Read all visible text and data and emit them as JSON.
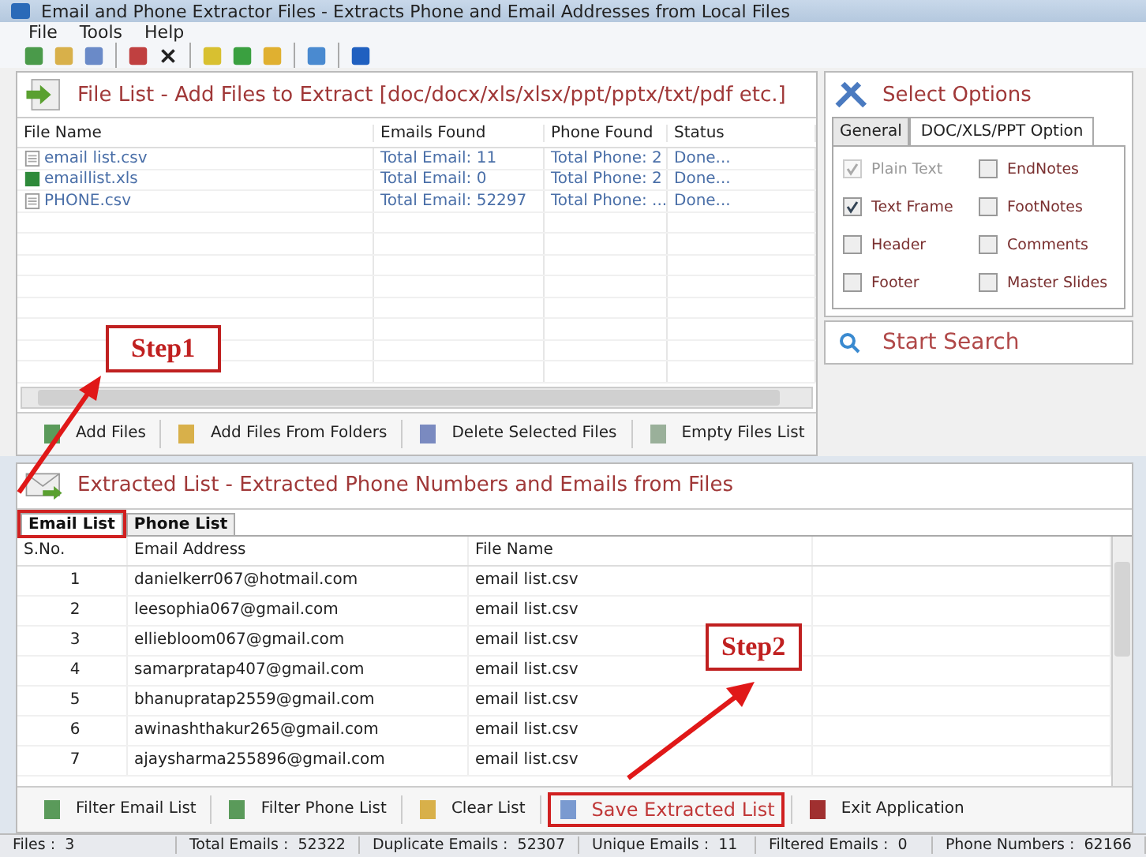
{
  "window": {
    "title": "Email and Phone Extractor Files  -  Extracts Phone and Email Addresses from Local Files"
  },
  "menu": [
    "File",
    "Tools",
    "Help"
  ],
  "file_list": {
    "title": "File List - Add Files to Extract  [doc/docx/xls/xlsx/ppt/pptx/txt/pdf etc.]",
    "columns": [
      "File Name",
      "Emails Found",
      "Phone Found",
      "Status"
    ],
    "rows": [
      {
        "kind": "text",
        "name": "email list.csv",
        "emails": "Total Email: 11",
        "phones": "Total Phone: 2",
        "status": "Done..."
      },
      {
        "kind": "sheet",
        "name": "emaillist.xls",
        "emails": "Total Email: 0",
        "phones": "Total Phone: 2",
        "status": "Done..."
      },
      {
        "kind": "text",
        "name": "PHONE.csv",
        "emails": "Total Email: 52297",
        "phones": "Total Phone: ...",
        "status": "Done..."
      }
    ],
    "buttons": [
      "Add Files",
      "Add Files From Folders",
      "Delete Selected Files",
      "Empty Files List"
    ]
  },
  "options": {
    "title": "Select Options",
    "tabs": [
      {
        "label": "General",
        "selected": false
      },
      {
        "label": "DOC/XLS/PPT Option",
        "selected": true
      }
    ],
    "checkboxes": [
      {
        "label": "Plain Text",
        "checked": true,
        "disabled": true
      },
      {
        "label": "EndNotes",
        "checked": false,
        "disabled": false
      },
      {
        "label": "Text Frame",
        "checked": true,
        "disabled": false
      },
      {
        "label": "FootNotes",
        "checked": false,
        "disabled": false
      },
      {
        "label": "Header",
        "checked": false,
        "disabled": false
      },
      {
        "label": "Comments",
        "checked": false,
        "disabled": false
      },
      {
        "label": "Footer",
        "checked": false,
        "disabled": false
      },
      {
        "label": "Master Slides",
        "checked": false,
        "disabled": false
      }
    ],
    "start_button": "Start Search"
  },
  "extracted": {
    "title": "Extracted List - Extracted Phone Numbers and Emails from Files",
    "tabs": [
      {
        "label": "Email List",
        "selected": true,
        "highlighted": true
      },
      {
        "label": "Phone List",
        "selected": false,
        "highlighted": false
      }
    ],
    "columns": [
      "S.No.",
      "Email Address",
      "File Name"
    ],
    "rows": [
      {
        "no": "1",
        "email": "danielkerr067@hotmail.com",
        "file": "email list.csv"
      },
      {
        "no": "2",
        "email": "leesophia067@gmail.com",
        "file": "email list.csv"
      },
      {
        "no": "3",
        "email": "elliebloom067@gmail.com",
        "file": "email list.csv"
      },
      {
        "no": "4",
        "email": "samarpratap407@gmail.com",
        "file": "email list.csv"
      },
      {
        "no": "5",
        "email": "bhanupratap2559@gmail.com",
        "file": "email list.csv"
      },
      {
        "no": "6",
        "email": "awinashthakur265@gmail.com",
        "file": "email list.csv"
      },
      {
        "no": "7",
        "email": "ajaysharma255896@gmail.com",
        "file": "email list.csv"
      }
    ],
    "buttons": [
      {
        "label": "Filter Email List",
        "highlighted": false
      },
      {
        "label": "Filter Phone List",
        "highlighted": false
      },
      {
        "label": "Clear List",
        "highlighted": false
      },
      {
        "label": "Save Extracted List",
        "highlighted": true
      },
      {
        "label": "Exit Application",
        "highlighted": false
      }
    ]
  },
  "status_bar": [
    {
      "label": "Files :",
      "value": "3"
    },
    {
      "label": "Total Emails :",
      "value": "52322"
    },
    {
      "label": "Duplicate Emails :",
      "value": "52307"
    },
    {
      "label": "Unique Emails :",
      "value": "11"
    },
    {
      "label": "Filtered Emails :",
      "value": "0"
    },
    {
      "label": "Phone Numbers :",
      "value": "62166"
    }
  ],
  "annotations": [
    "Step1",
    "Step2"
  ]
}
